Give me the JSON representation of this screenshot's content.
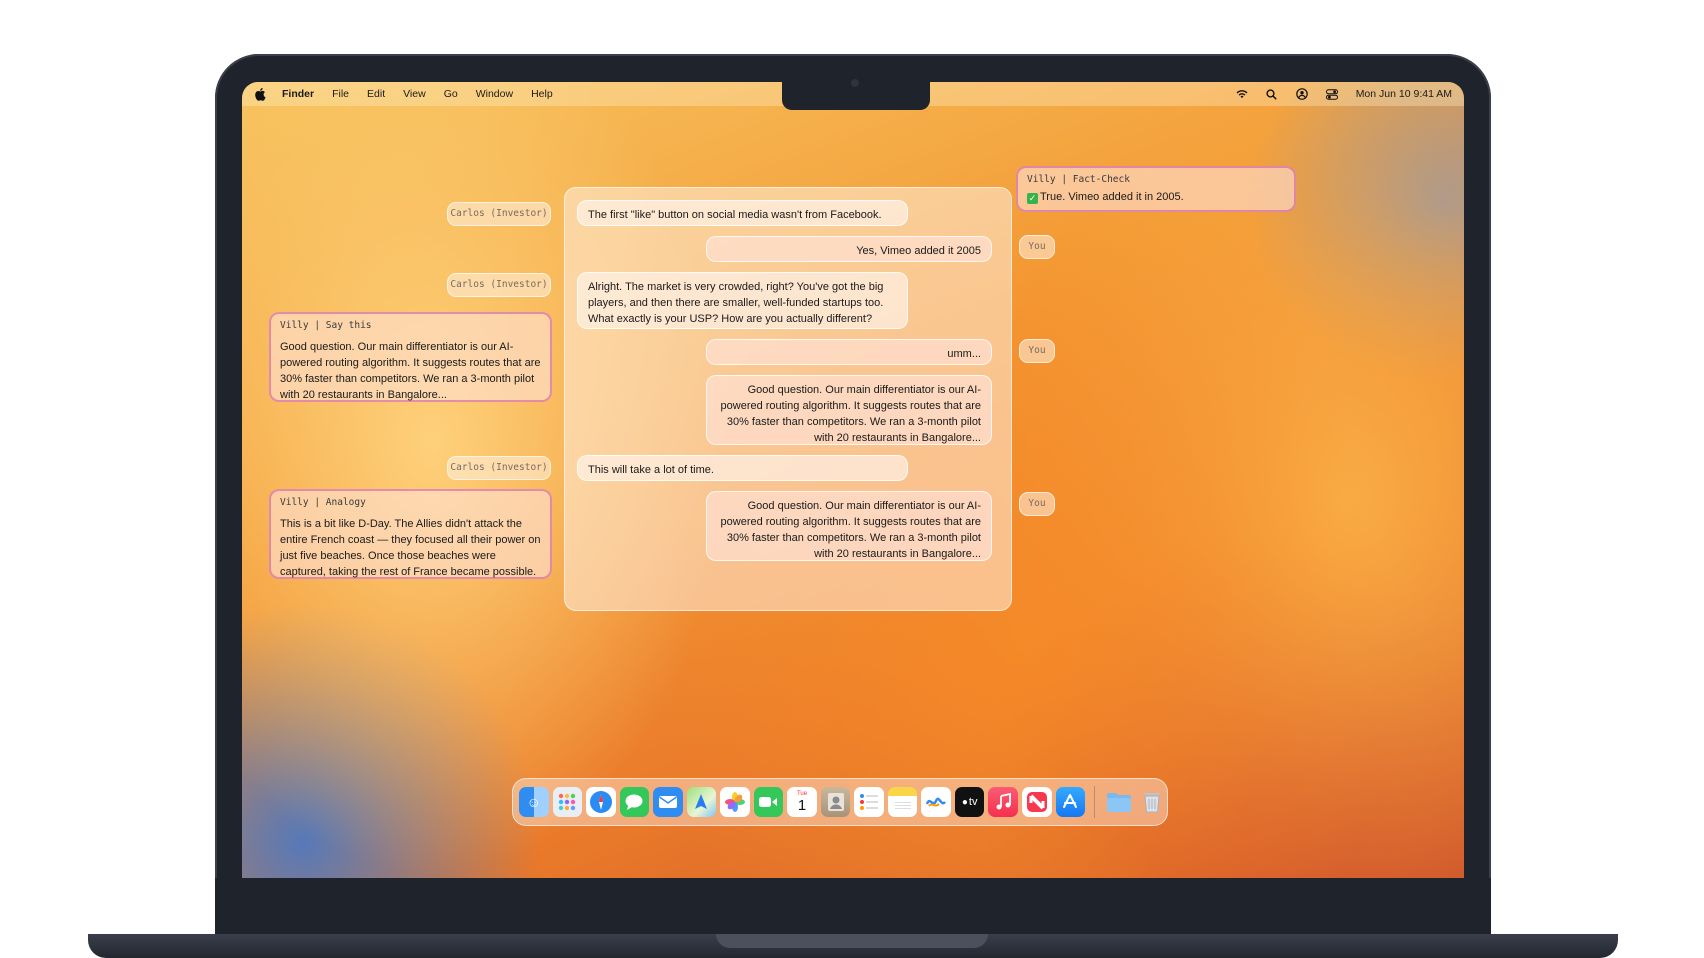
{
  "menubar": {
    "apple": "",
    "app": "Finder",
    "items": [
      "File",
      "Edit",
      "View",
      "Go",
      "Window",
      "Help"
    ],
    "clock": "Mon Jun 10  9:41 AM"
  },
  "speakers": {
    "investor": "Carlos (Investor)",
    "you": "You"
  },
  "villy": {
    "fact_check": {
      "head": "Villy | Fact-Check",
      "body": "True. Vimeo added it in 2005."
    },
    "say_this": {
      "head": "Villy | Say this",
      "body": "Good question. Our main differentiator is our AI-powered routing algorithm. It suggests routes that are 30% faster than competitors. We ran a 3-month pilot with 20 restaurants in Bangalore..."
    },
    "analogy": {
      "head": "Villy | Analogy",
      "body": "This is a bit like D-Day. The Allies didn't attack the entire French coast — they focused all their power on just five beaches. Once those beaches were captured, taking the rest of France became possible."
    }
  },
  "messages": [
    {
      "from": "investor",
      "text": "The first \"like\" button on social media wasn't from Facebook."
    },
    {
      "from": "you",
      "text": "Yes, Vimeo added it 2005"
    },
    {
      "from": "investor",
      "text": "Alright. The market is very crowded, right? You've got the big players, and then there are smaller, well-funded startups too. What exactly is your USP? How are you actually different?"
    },
    {
      "from": "you",
      "text": "umm..."
    },
    {
      "from": "you",
      "text": "Good question. Our main differentiator is our AI-powered routing algorithm. It suggests routes that are 30% faster than competitors. We ran a 3-month pilot with 20 restaurants in Bangalore..."
    },
    {
      "from": "investor",
      "text": "This will take a lot of time."
    },
    {
      "from": "you",
      "text": "Good question. Our main differentiator is our AI-powered routing algorithm. It suggests routes that are 30% faster than competitors. We ran a 3-month pilot with 20 restaurants in Bangalore..."
    }
  ],
  "dock": {
    "calendar_month": "Tue",
    "calendar_day": "1",
    "tv_label": "tv",
    "items": [
      "finder-icon",
      "launchpad-icon",
      "safari-icon",
      "messages-icon",
      "mail-icon",
      "maps-icon",
      "photos-icon",
      "facetime-icon",
      "calendar-icon",
      "contacts-icon",
      "reminders-icon",
      "notes-icon",
      "freeform-icon",
      "apple-tv-icon",
      "music-icon",
      "news-icon",
      "app-store-icon",
      "downloads-folder-icon",
      "trash-icon"
    ]
  },
  "colors": {
    "villy_border": "#cd50aa",
    "check_green": "#37b24d"
  }
}
